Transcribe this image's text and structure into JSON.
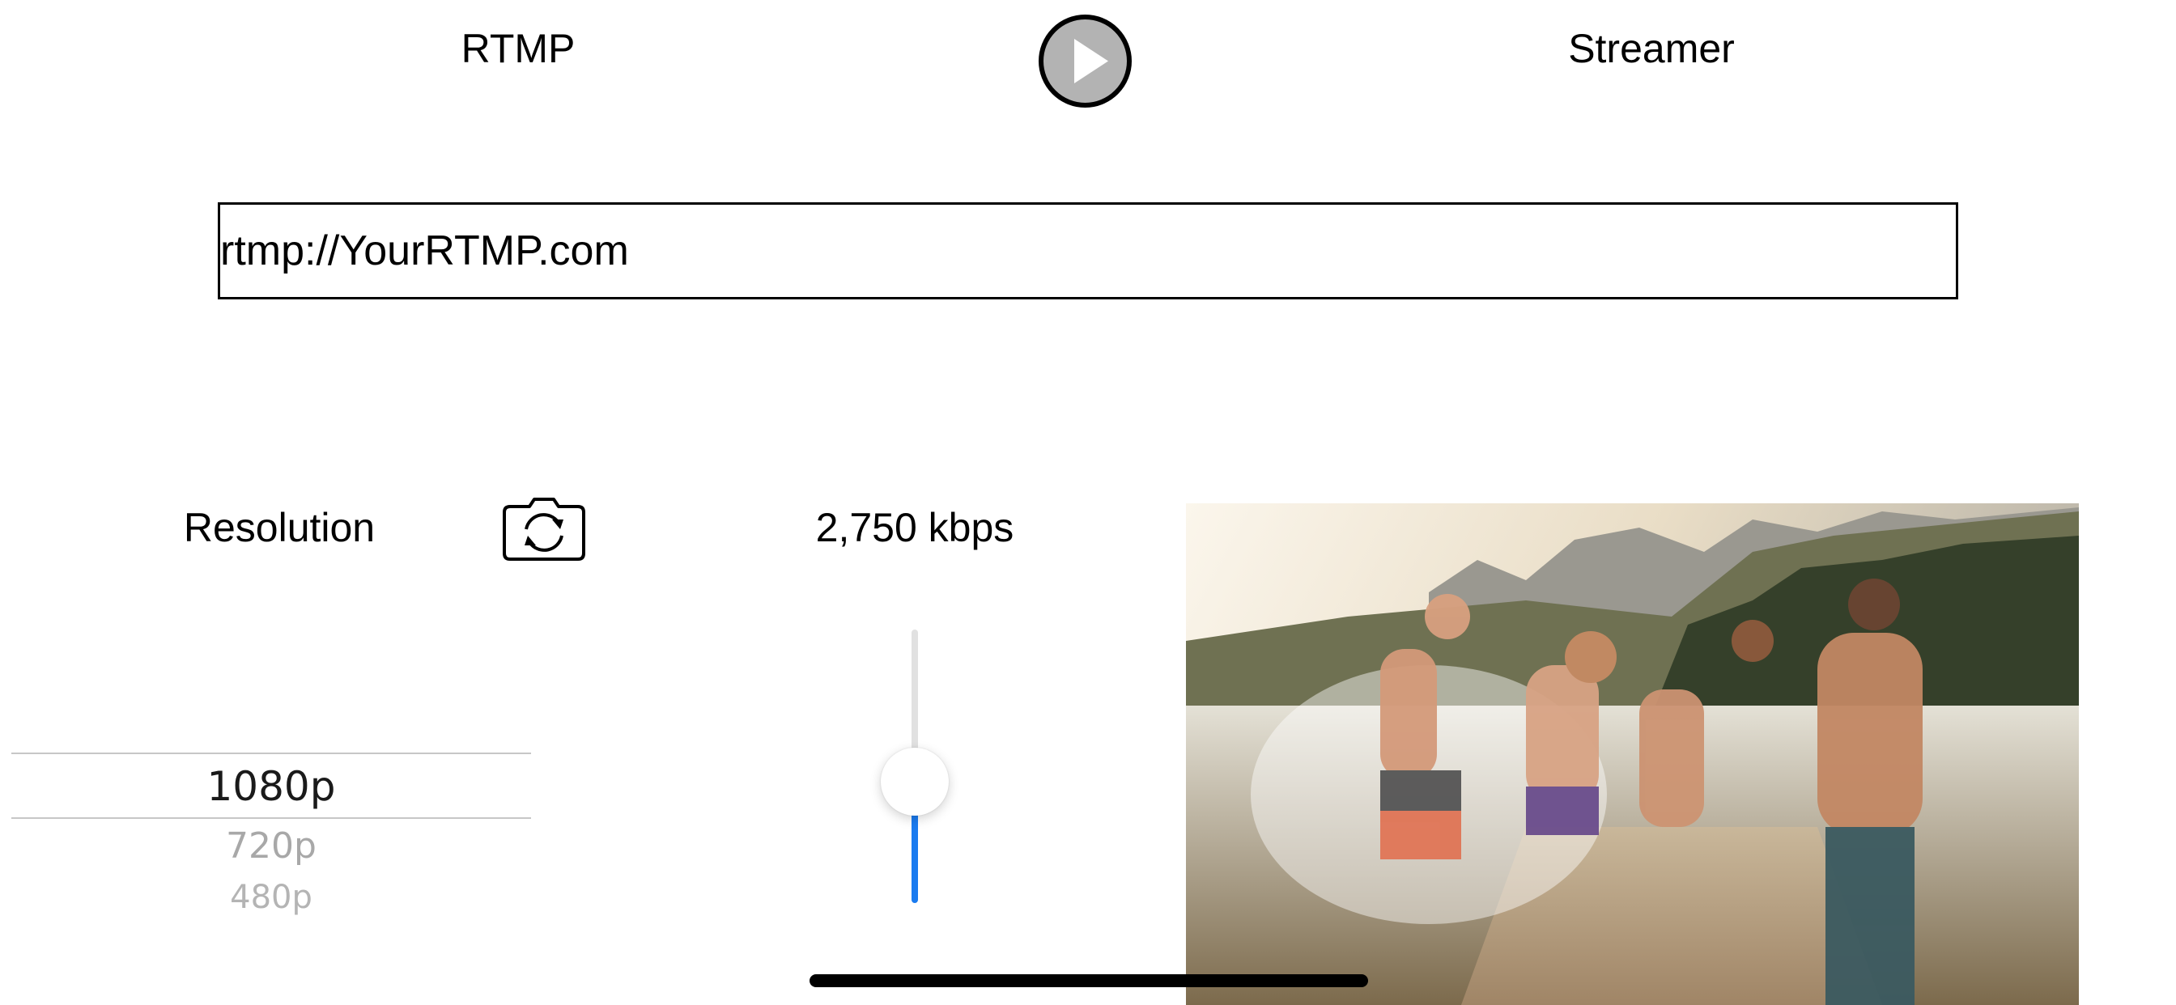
{
  "header": {
    "left_title": "RTMP",
    "right_title": "Streamer"
  },
  "stream_url": {
    "value": "rtmp://YourRTMP.com"
  },
  "controls": {
    "resolution_label": "Resolution",
    "bitrate_label": "2,750 kbps",
    "camera_switch_icon": "camera-rotate-icon"
  },
  "resolution_picker": {
    "selected": "1080p",
    "options": [
      "1080p",
      "720p",
      "480p"
    ]
  },
  "bitrate_slider": {
    "fraction": 0.45
  },
  "colors": {
    "play_fill": "#b3b3b3",
    "slider_active": "#1a7bf0",
    "slider_inactive": "#e1e1e1"
  }
}
